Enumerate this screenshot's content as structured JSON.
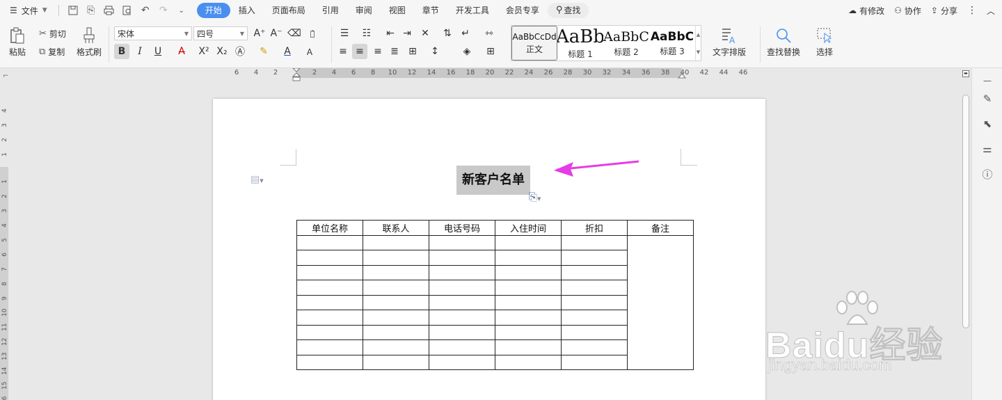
{
  "menubar": {
    "file_label": "文件",
    "tabs": [
      "开始",
      "插入",
      "页面布局",
      "引用",
      "审阅",
      "视图",
      "章节",
      "开发工具",
      "会员专享"
    ],
    "search_label": "查找",
    "right": {
      "modified": "有修改",
      "collab": "协作",
      "share": "分享"
    }
  },
  "ribbon": {
    "paste": "粘贴",
    "cut": "剪切",
    "copy": "复制",
    "format_painter": "格式刷",
    "font_name": "宋体",
    "font_size": "四号",
    "styles": [
      {
        "preview": "AaBbCcDd",
        "name": "正文"
      },
      {
        "preview": "AaBb",
        "name": "标题 1"
      },
      {
        "preview": "AaBbC",
        "name": "标题 2"
      },
      {
        "preview": "AaBbC",
        "name": "标题 3"
      }
    ],
    "text_layout": "文字排版",
    "find_replace": "查找替换",
    "select": "选择"
  },
  "ruler": {
    "h_ticks": [
      "6",
      "4",
      "2",
      "2",
      "4",
      "6",
      "8",
      "10",
      "12",
      "14",
      "16",
      "18",
      "20",
      "22",
      "24",
      "26",
      "28",
      "30",
      "32",
      "34",
      "36",
      "38",
      "40",
      "42",
      "44",
      "46"
    ],
    "v_ticks": [
      "4",
      "3",
      "2",
      "1",
      "1",
      "2",
      "3",
      "4",
      "5",
      "6",
      "7",
      "8",
      "9",
      "10",
      "11",
      "12",
      "13",
      "14",
      "15",
      "16"
    ]
  },
  "document": {
    "title": "新客户名单",
    "table": {
      "headers": [
        "单位名称",
        "联系人",
        "电话号码",
        "入住时间",
        "折扣",
        "备注"
      ],
      "empty_rows": 9
    }
  },
  "watermark": {
    "brand": "Baidu经验",
    "url": "jingyan.baidu.com"
  },
  "colors": {
    "accent": "#4a8ff0",
    "arrow": "#e53ce5",
    "selection": "#c9c9c9"
  }
}
